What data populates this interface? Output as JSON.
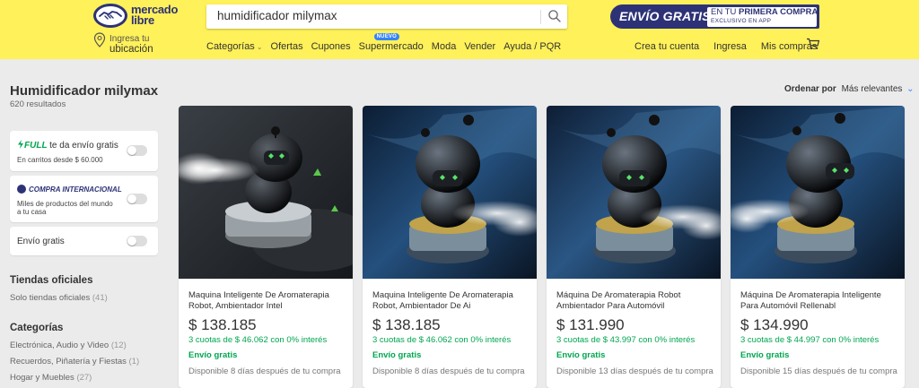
{
  "header": {
    "logo_line1": "mercado",
    "logo_line2": "libre",
    "search_value": "humidificador milymax",
    "promo": {
      "main": "ENVÍO GRATIS",
      "line1_pre": "EN TU",
      "line1_bold": "PRIMERA COMPRA",
      "line2": "EXCLUSIVO EN APP"
    },
    "location_line1": "Ingresa tu",
    "location_line2": "ubicación",
    "nav": [
      {
        "label": "Categorías",
        "has_chevron": true
      },
      {
        "label": "Ofertas"
      },
      {
        "label": "Cupones"
      },
      {
        "label": "Supermercado",
        "badge": "NUEVO"
      },
      {
        "label": "Moda"
      },
      {
        "label": "Vender"
      },
      {
        "label": "Ayuda / PQR"
      }
    ],
    "user_links": [
      "Crea tu cuenta",
      "Ingresa",
      "Mis compras"
    ]
  },
  "results": {
    "title": "Humidificador milymax",
    "count": "620 resultados"
  },
  "filters": {
    "full": {
      "tag": "FULL",
      "label": "te da envío gratis",
      "sub": "En carritos desde $ 60.000"
    },
    "intl": {
      "label": "COMPRA INTERNACIONAL",
      "sub_line1": "Miles de productos del mundo",
      "sub_line2": "a tu casa"
    },
    "free_shipping": {
      "label": "Envío gratis"
    }
  },
  "sidebar": {
    "official_title": "Tiendas oficiales",
    "official_link": {
      "label": "Solo tiendas oficiales",
      "count": "(41)"
    },
    "categories_title": "Categorías",
    "categories": [
      {
        "label": "Electrónica, Audio y Video",
        "count": "(12)"
      },
      {
        "label": "Recuerdos, Piñatería y Fiestas",
        "count": "(1)"
      },
      {
        "label": "Hogar y Muebles",
        "count": "(27)"
      }
    ]
  },
  "sort": {
    "label": "Ordenar por",
    "value": "Más relevantes"
  },
  "products": [
    {
      "title": "Maquina Inteligente De Aromaterapia Robot, Ambientador Intel",
      "price": "$ 138.185",
      "installments": "3 cuotas de $ 46.062 con 0% interés",
      "shipping": "Envío gratis",
      "availability": "Disponible 8 días después de tu compra"
    },
    {
      "title": "Maquina Inteligente De Aromaterapia Robot, Ambientador De Ai",
      "price": "$ 138.185",
      "installments": "3 cuotas de $ 46.062 con 0% interés",
      "shipping": "Envío gratis",
      "availability": "Disponible 8 días después de tu compra"
    },
    {
      "title": "Máquina De Aromaterapia Robot Ambientador Para Automóvil",
      "price": "$ 131.990",
      "installments": "3 cuotas de $ 43.997 con 0% interés",
      "shipping": "Envío gratis",
      "availability": "Disponible 13 días después de tu compra"
    },
    {
      "title": "Máquina De Aromaterapia Inteligente Para Automóvil Rellenabl",
      "price": "$ 134.990",
      "installments": "3 cuotas de $ 44.997 con 0% interés",
      "shipping": "Envío gratis",
      "availability": "Disponible 15 días después de tu compra"
    }
  ],
  "colors": {
    "header_bg": "#fff159",
    "brand_navy": "#2d3277",
    "accent_blue": "#3483fa",
    "green": "#00a650"
  }
}
